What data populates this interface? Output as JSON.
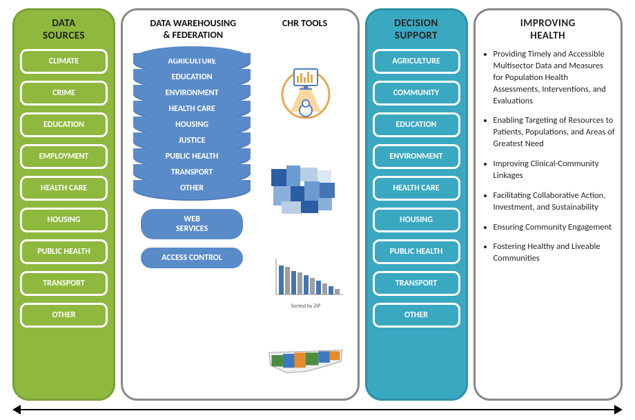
{
  "sources": {
    "title": "DATA\nSOURCES",
    "items": [
      "CLIMATE",
      "CRIME",
      "EDUCATION",
      "EMPLOYMENT",
      "HEALTH CARE",
      "HOUSING",
      "PUBLIC HEALTH",
      "TRANSPORT",
      "OTHER"
    ]
  },
  "warehousing": {
    "title": "DATA WAREHOUSING\n& FEDERATION",
    "cylinder_layers": [
      "AGRICULTURE",
      "EDUCATION",
      "ENVIRONMENT",
      "HEALTH CARE",
      "HOUSING",
      "JUSTICE",
      "PUBLIC HEALTH",
      "TRANSPORT",
      "OTHER"
    ],
    "pills": [
      "WEB\nSERVICES",
      "ACCESS CONTROL"
    ]
  },
  "chr_tools": {
    "title": "CHR TOOLS",
    "graphics": [
      "dashboard-chart-icon",
      "choropleth-map-icon",
      "bar-chart-icon",
      "state-map-icon"
    ],
    "bar_chart_caption": "Sorted by ZIP"
  },
  "decision": {
    "title": "DECISION\nSUPPORT",
    "items": [
      "AGRICULTURE",
      "COMMUNITY",
      "EDUCATION",
      "ENVIRONMENT",
      "HEALTH CARE",
      "HOUSING",
      "PUBLIC HEALTH",
      "TRANSPORT",
      "OTHER"
    ]
  },
  "improving": {
    "title": "IMPROVING\nHEALTH",
    "bullets": [
      "Providing Timely and Accessible Multisector Data and Measures for Population Health Assessments, Interventions, and Evaluations",
      "Enabling Targeting of Resources to Patients, Populations, and Areas of Greatest Need",
      "Improving Clinical-Community Linkages",
      "Facilitating Collaborative Action, Investment, and Sustainability",
      "Ensuring Community Engagement",
      "Fostering Healthy and Liveable Communities"
    ]
  },
  "colors": {
    "green": "#8fb83e",
    "blue": "#5a8bc9",
    "teal": "#3aa8c1"
  }
}
